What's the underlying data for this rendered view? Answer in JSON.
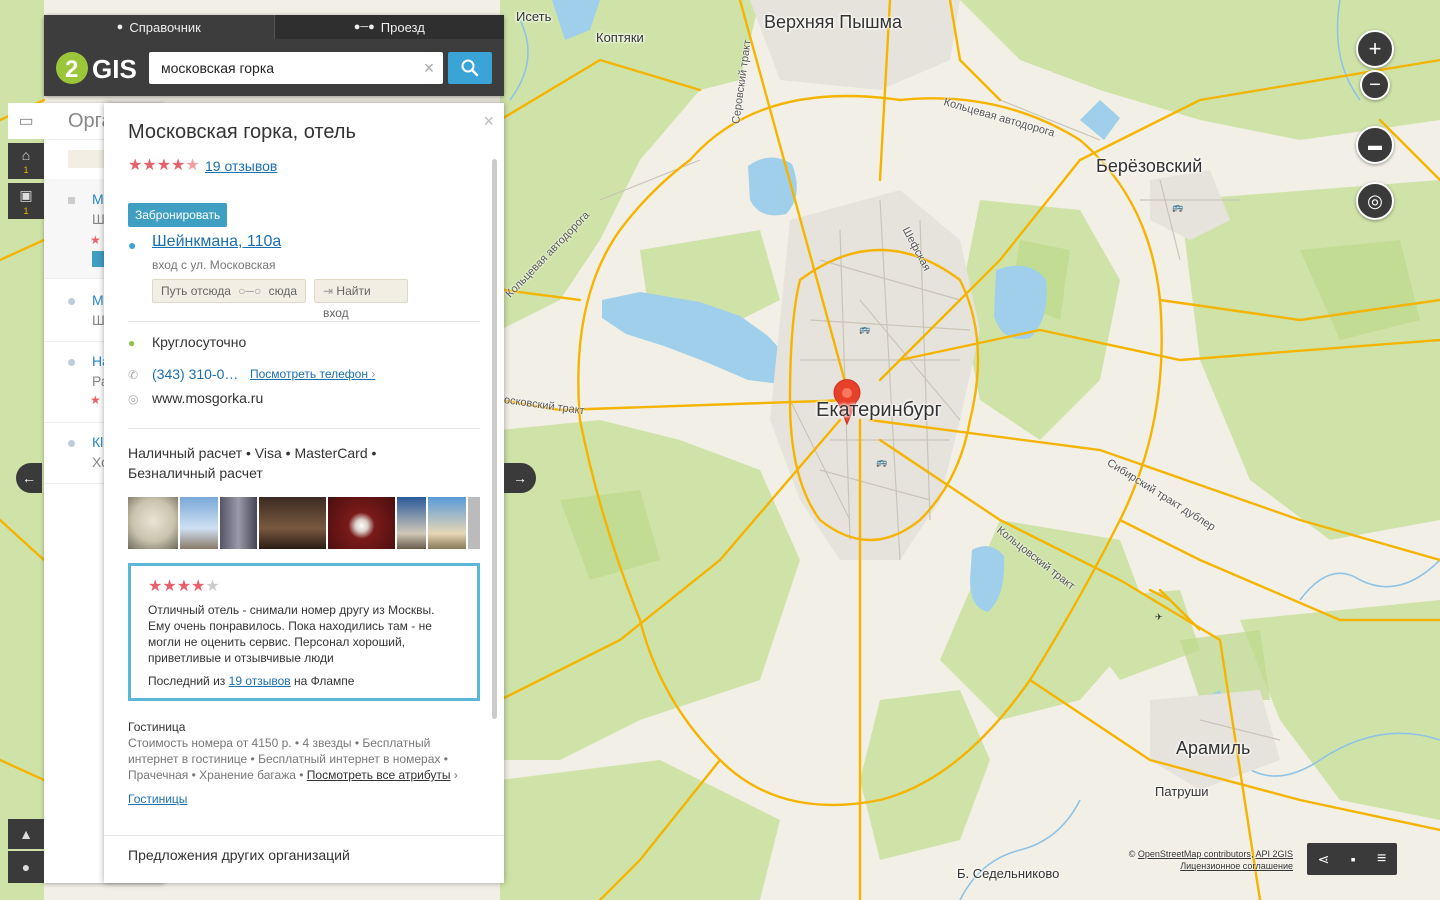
{
  "tabs": [
    {
      "label": "Справочник",
      "icon": "pin-icon"
    },
    {
      "label": "Проезд",
      "icon": "route-icon"
    }
  ],
  "logo_text": "2GIS",
  "search": {
    "value": "московская горка"
  },
  "list": {
    "heading": "Орга",
    "items": [
      {
        "title": "М",
        "subtitle": "Ш"
      },
      {
        "title": "М",
        "subtitle": "Ш"
      },
      {
        "title": "На",
        "subtitle": "Ра"
      },
      {
        "title": "Кl",
        "subtitle": "Хо"
      }
    ],
    "toolbar_counts": [
      "1",
      "1"
    ]
  },
  "card": {
    "title": "Московская горка, отель",
    "rating": 4.5,
    "reviews_link": "19 отзывов",
    "book_button": "Забронировать",
    "address": "Шейнкмана, 110а",
    "address_note": "вход с ул. Московская",
    "route_from": "Путь отсюда",
    "route_to": "сюда",
    "find_entrance": "Найти вход",
    "hours": "Круглосуточно",
    "phone": "(343) 310-0…",
    "phone_more": "Посмотреть телефон",
    "website": "www.mosgorka.ru",
    "payment": "Наличный расчет • Visa • MasterCard • Безналичный расчет",
    "review": {
      "rating": 4,
      "text": "Отличный отель - снимали номер другу из Москвы. Ему очень понравилось. Пока находились там - не могли не оценить сервис. Персонал хороший, приветливые и отзывчивые люди",
      "footer_prefix": "Последний из",
      "footer_link": "19 отзывов",
      "footer_suffix": "на Флампе"
    },
    "category": "Гостиница",
    "attributes": "Стоимость номера от 4150 р. • 4 звезды • Бесплатный интернет в гостинице • Бесплатный интернет в номерах • Прачечная • Хранение багажа •",
    "attributes_link": "Посмотреть все атрибуты",
    "category_link": "Гостиницы",
    "offers": "Предложения других организаций"
  },
  "map": {
    "cities": [
      "Верхняя Пышма",
      "Березовский",
      "Екатеринбург",
      "Арамиль"
    ],
    "places": [
      "Исеть",
      "Коптяки",
      "Патруши",
      "Б. Седельниково"
    ],
    "roads": [
      "Кольцевая автодорога",
      "Серовский тракт",
      "Шефская",
      "Кольцевая автодорога",
      "осковский тракт",
      "Сибирский тракт дублер",
      "Кольцовский тракт"
    ],
    "city_label_berezovsky": "Берёзовский",
    "colors": {
      "forest": "#cfe3a8",
      "land": "#f2efe6",
      "water": "#9fcfea",
      "road": "#f5b400",
      "pin": "#e8412b"
    }
  },
  "attribution": {
    "osm": "OpenStreetMap contributors",
    "sep": ",",
    "api": "API 2GIS",
    "license": "Лицензионное соглашение",
    "copy": "©"
  }
}
